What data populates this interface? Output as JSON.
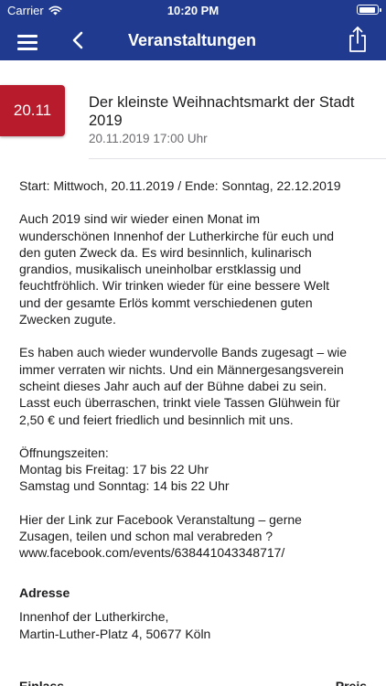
{
  "status_bar": {
    "carrier": "Carrier",
    "time": "10:20 PM",
    "icons": [
      "wifi-icon",
      "battery-icon"
    ]
  },
  "nav": {
    "title": "Veranstaltungen",
    "icons": [
      "menu-icon",
      "chevron-left-icon",
      "share-icon"
    ]
  },
  "colors": {
    "nav_background": "#1f3a8f",
    "date_badge": "#b81b2b"
  },
  "event": {
    "date_badge": "20.11",
    "title": "Der kleinste Weihnachtsmarkt der Stadt 2019",
    "datetime": "20.11.2019 17:00 Uhr"
  },
  "body": {
    "paragraphs": [
      "Start: Mittwoch, 20.11.2019 / Ende: Sonntag, 22.12.2019",
      "Auch 2019 sind wir wieder einen Monat im\nwunderschönen Innenhof der Lutherkirche für euch und\nden guten Zweck da. Es wird besinnlich, kulinarisch\ngrandios, musikalisch uneinholbar erstklassig und\nfeuchtfröhlich. Wir trinken wieder für eine bessere Welt\nund der gesamte Erlös kommt verschiedenen guten\nZwecken zugute.",
      "Es haben auch wieder wundervolle Bands zugesagt – wie\nimmer verraten wir nichts. Und ein Männergesangsverein\nscheint dieses Jahr auch auf der Bühne dabei zu sein.\nLasst euch überraschen, trinkt viele Tassen Glühwein für\n2,50 € und feiert friedlich und besinnlich mit uns.",
      "Öffnungszeiten:\nMontag bis Freitag: 17 bis 22 Uhr\nSamstag und Sonntag: 14 bis 22 Uhr",
      "Hier der Link zur Facebook Veranstaltung – gerne\nZusagen, teilen und schon mal verabreden ?\nwww.facebook.com/events/638441043348717/"
    ]
  },
  "address": {
    "label": "Adresse",
    "line1": "Innenhof der Lutherkirche,",
    "line2": "Martin-Luther-Platz 4, 50677 Köln"
  },
  "footer_partial": {
    "left": "Einlass",
    "right": "Preis"
  }
}
